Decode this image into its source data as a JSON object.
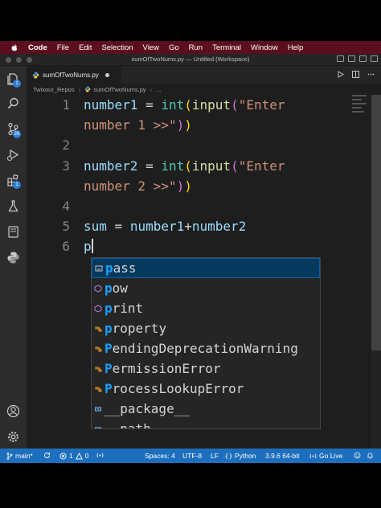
{
  "menubar": {
    "items": [
      "Code",
      "File",
      "Edit",
      "Selection",
      "View",
      "Go",
      "Run",
      "Terminal",
      "Window",
      "Help"
    ]
  },
  "window": {
    "title": "sumOfTwoNums.py — Untitled (Workspace)"
  },
  "activity_bar": {
    "explorer_badge": "1",
    "scm_badge": "26",
    "extensions_badge": "1"
  },
  "tab": {
    "label": "sumOfTwoNums.py"
  },
  "breadcrumb": {
    "folder": "Twixour_Repos",
    "file": "sumOfTwoNums.py",
    "ellipsis": "..."
  },
  "editor": {
    "line_numbers": [
      "1",
      "2",
      "3",
      "4",
      "5",
      "6"
    ],
    "line1": {
      "var": "number1",
      "eq": " = ",
      "int": "int",
      "p1": "(",
      "input": "input",
      "p2": "(",
      "str": "\"Enter"
    },
    "line1b": {
      "str": "number 1 >>\"",
      "p2": ")",
      "p1": ")"
    },
    "line3": {
      "var": "number2",
      "eq": " = ",
      "int": "int",
      "p1": "(",
      "input": "input",
      "p2": "(",
      "str": "\"Enter"
    },
    "line3b": {
      "str": "number 2 >>\"",
      "p2": ")",
      "p1": ")"
    },
    "line5": {
      "var": "sum",
      "eq": " = ",
      "a": "number1",
      "plus": "+",
      "b": "number2"
    },
    "line6": {
      "typed": "p"
    }
  },
  "suggestions": [
    {
      "match": "p",
      "rest": "ass",
      "kind": "keyword"
    },
    {
      "match": "p",
      "rest": "ow",
      "kind": "function"
    },
    {
      "match": "p",
      "rest": "rint",
      "kind": "function"
    },
    {
      "match": "p",
      "rest": "roperty",
      "kind": "class"
    },
    {
      "match": "P",
      "rest": "endingDeprecationWarning",
      "kind": "class"
    },
    {
      "match": "P",
      "rest": "ermissionError",
      "kind": "class"
    },
    {
      "match": "P",
      "rest": "rocessLookupError",
      "kind": "class"
    },
    {
      "match": "",
      "rest": "__package__",
      "kind": "variable"
    },
    {
      "match": "",
      "rest": "__path__",
      "kind": "variable"
    }
  ],
  "statusbar": {
    "branch": "main*",
    "problems_errors": "1",
    "problems_warnings": "0",
    "spaces": "Spaces: 4",
    "encoding": "UTF-8",
    "eol": "LF",
    "language": "Python",
    "interpreter": "3.9.6 64-bit",
    "go_live": "Go Live"
  },
  "colors": {
    "menubar_bg": "#5b0e1e",
    "statusbar_bg": "#1d6fbd",
    "editor_bg": "#1e1e1e",
    "suggest_match": "#18a3ff",
    "selected_bg": "#04395e"
  },
  "icons": [
    "apple-icon",
    "files-icon",
    "search-icon",
    "source-control-icon",
    "run-debug-icon",
    "extensions-icon",
    "testing-icon",
    "remote-icon",
    "python-icon",
    "account-icon",
    "settings-gear-icon",
    "python-file-icon",
    "run-icon",
    "split-editor-icon",
    "more-icon",
    "branch-icon",
    "sync-icon",
    "error-icon",
    "warning-icon",
    "broadcast-icon",
    "bell-icon"
  ]
}
